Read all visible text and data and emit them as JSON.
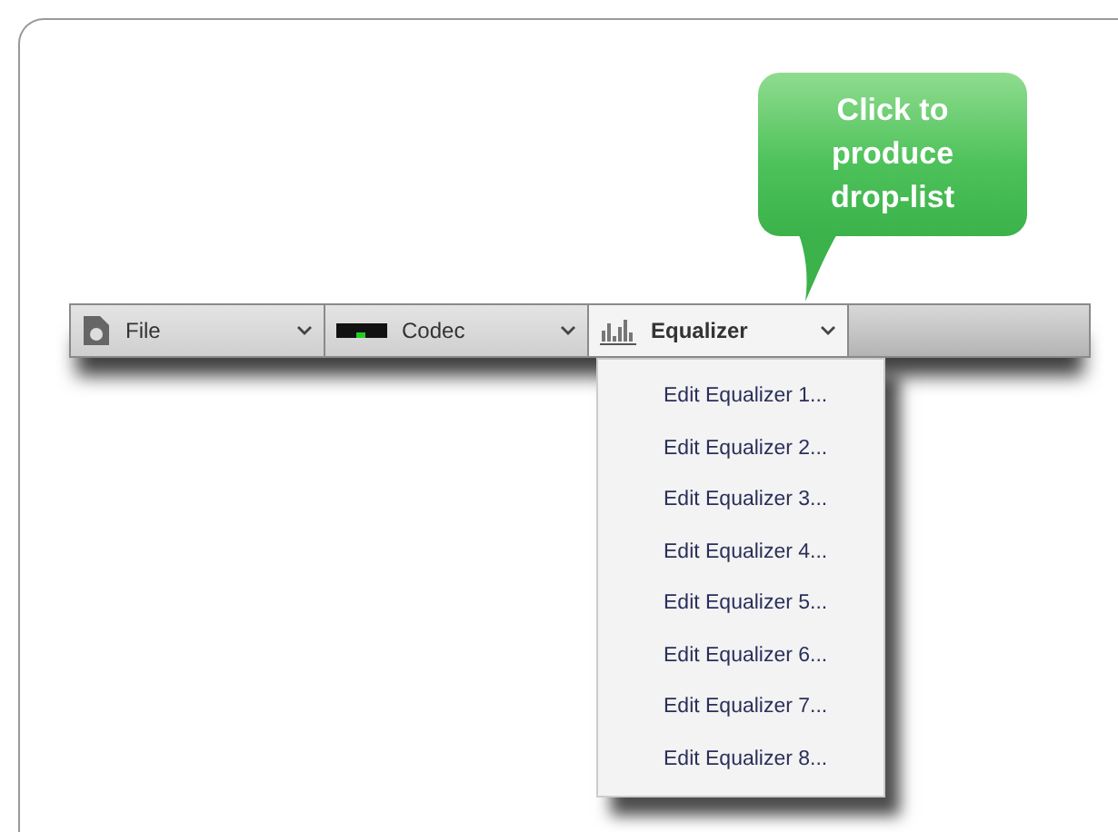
{
  "callout": {
    "text": "Click to produce drop-list"
  },
  "toolbar": {
    "dropdowns": [
      {
        "kind": "file",
        "label": "File",
        "selected": false
      },
      {
        "kind": "codec",
        "label": "Codec",
        "selected": false
      },
      {
        "kind": "equalizer",
        "label": "Equalizer",
        "selected": true
      }
    ]
  },
  "menu": {
    "items": [
      {
        "label": "Edit Equalizer 1..."
      },
      {
        "label": "Edit Equalizer 2..."
      },
      {
        "label": "Edit Equalizer 3..."
      },
      {
        "label": "Edit Equalizer 4..."
      },
      {
        "label": "Edit Equalizer 5..."
      },
      {
        "label": "Edit Equalizer 6..."
      },
      {
        "label": "Edit Equalizer 7..."
      },
      {
        "label": "Edit Equalizer 8..."
      }
    ]
  }
}
